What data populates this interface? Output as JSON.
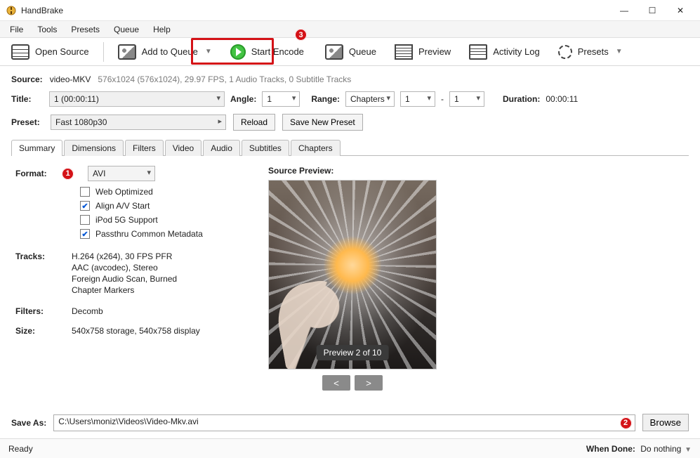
{
  "window": {
    "title": "HandBrake"
  },
  "menu": {
    "items": [
      "File",
      "Tools",
      "Presets",
      "Queue",
      "Help"
    ]
  },
  "toolbar": {
    "open_source": "Open Source",
    "add_to_queue": "Add to Queue",
    "start_encode": "Start Encode",
    "queue": "Queue",
    "preview": "Preview",
    "activity_log": "Activity Log",
    "presets": "Presets"
  },
  "source": {
    "label": "Source:",
    "name": "video-MKV",
    "details": "576x1024 (576x1024), 29.97 FPS, 1 Audio Tracks, 0 Subtitle Tracks"
  },
  "title_row": {
    "title_label": "Title:",
    "title_value": "1  (00:00:11)",
    "angle_label": "Angle:",
    "angle_value": "1",
    "range_label": "Range:",
    "range_type": "Chapters",
    "range_start": "1",
    "range_dash": "-",
    "range_end": "1",
    "duration_label": "Duration:",
    "duration_value": "00:00:11"
  },
  "preset_row": {
    "preset_label": "Preset:",
    "preset_value": "Fast 1080p30",
    "reload": "Reload",
    "save_new_preset": "Save New Preset"
  },
  "tabs": [
    "Summary",
    "Dimensions",
    "Filters",
    "Video",
    "Audio",
    "Subtitles",
    "Chapters"
  ],
  "summary": {
    "format_label": "Format:",
    "format_value": "AVI",
    "checkboxes": {
      "web_optimized": {
        "label": "Web Optimized",
        "checked": false
      },
      "align_av": {
        "label": "Align A/V Start",
        "checked": true
      },
      "ipod": {
        "label": "iPod 5G Support",
        "checked": false
      },
      "passthru": {
        "label": "Passthru Common Metadata",
        "checked": true
      }
    },
    "tracks_label": "Tracks:",
    "tracks": [
      "H.264 (x264), 30 FPS PFR",
      "AAC (avcodec), Stereo",
      "Foreign Audio Scan, Burned",
      "Chapter Markers"
    ],
    "filters_label": "Filters:",
    "filters_value": "Decomb",
    "size_label": "Size:",
    "size_value": "540x758 storage, 540x758 display"
  },
  "preview": {
    "heading": "Source Preview:",
    "badge": "Preview 2 of 10",
    "prev": "<",
    "next": ">"
  },
  "save": {
    "label": "Save As:",
    "path": "C:\\Users\\moniz\\Videos\\Video-Mkv.avi",
    "browse": "Browse"
  },
  "status": {
    "ready": "Ready",
    "when_done_label": "When Done:",
    "when_done_value": "Do nothing"
  },
  "annotations": {
    "one": "1",
    "two": "2",
    "three": "3"
  }
}
